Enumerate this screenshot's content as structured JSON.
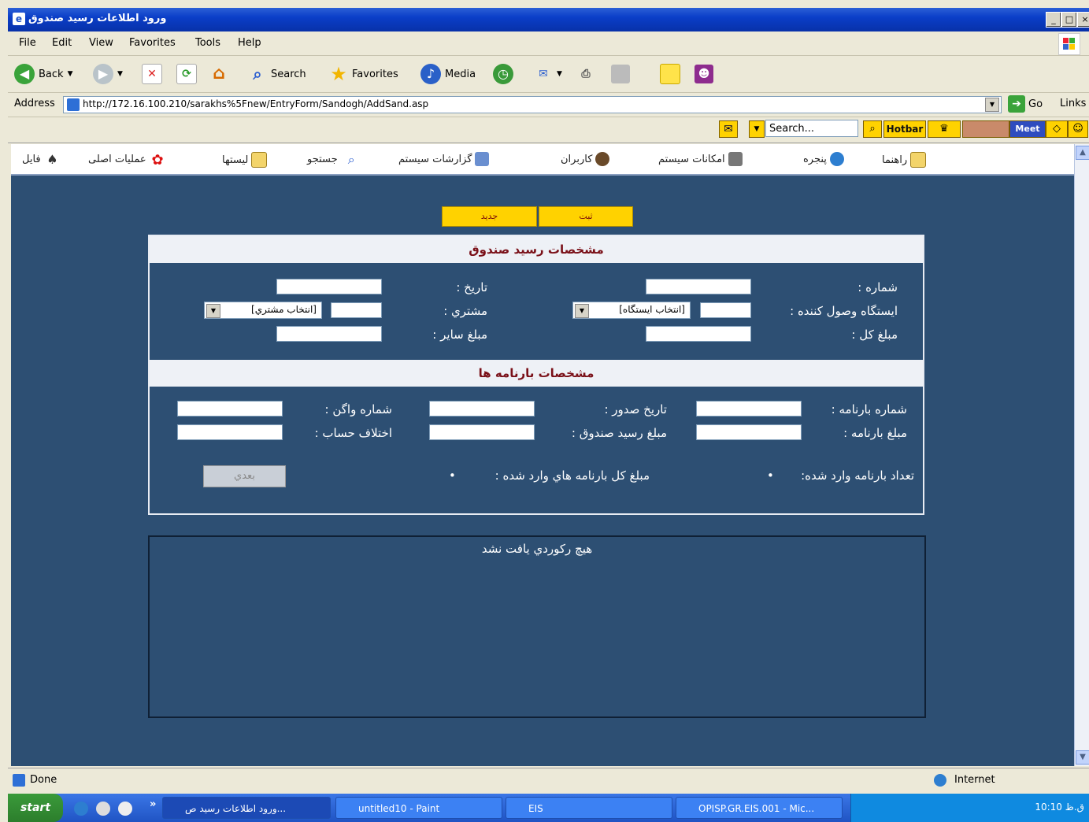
{
  "window": {
    "title": "ورود اطلاعات رسيد صندوق",
    "buttons": [
      "_",
      "□",
      "×"
    ]
  },
  "menu": [
    "File",
    "Edit",
    "View",
    "Favorites",
    "Tools",
    "Help"
  ],
  "toolbar": {
    "back": "Back",
    "search": "Search",
    "favorites": "Favorites",
    "media": "Media"
  },
  "address": {
    "label": "Address",
    "url": "http://172.16.100.210/sarakhs%5Fnew/EntryForm/Sandogh/AddSand.asp",
    "go": "Go",
    "links": "Links"
  },
  "searchbar": {
    "placeholder": "Search...",
    "hotbar": "Hotbar",
    "meet": "Meet"
  },
  "appnav": {
    "file": "فایل",
    "main_ops": "عملیات اصلی",
    "lists": "لیستها",
    "search": "جستجو",
    "system_reports": "گزارشات سیستم",
    "users": "کاربران",
    "system_facilities": "امکانات سیستم",
    "window": "پنجره",
    "help": "راهنما"
  },
  "actions": {
    "submit": "ثبت",
    "new": "جديد"
  },
  "receipt_section": {
    "title": "مشخصات رسيد صندوق",
    "number_label": "شماره :",
    "date_label": "تاريخ :",
    "station_label": "ايستگاه وصول کننده :",
    "station_select": "[انتخاب ايستگاه]",
    "customer_label": "مشتري :",
    "customer_select": "[انتخاب مشتري]",
    "total_label": "مبلغ کل :",
    "other_label": "مبلغ ساير :"
  },
  "waybill_section": {
    "title": "مشخصات بارنامه ها",
    "waybill_no_label": "شماره بارنامه :",
    "issue_date_label": "تاريخ صدور :",
    "wagon_no_label": "شماره واگن :",
    "waybill_amount_label": "مبلغ بارنامه :",
    "receipt_amount_label": "مبلغ رسيد صندوق :",
    "account_diff_label": "اختلاف حساب :",
    "count_label": "تعداد بارنامه وارد شده:",
    "count_value": "•",
    "total_amount_label": "مبلغ کل بارنامه هاي وارد شده :",
    "total_amount_value": "•",
    "next_button": "بعدي"
  },
  "results": {
    "empty_message": "هيچ رکوردي يافت نشد"
  },
  "status": {
    "text": "Done",
    "zone": "Internet"
  },
  "taskbar": {
    "start": "start",
    "tasks": [
      "ورود اطلاعات رسيد ص...",
      "untitled10 - Paint",
      "EIS",
      "OPISP.GR.EIS.001 - Mic..."
    ],
    "clock": "10:10 ق.ظ"
  }
}
